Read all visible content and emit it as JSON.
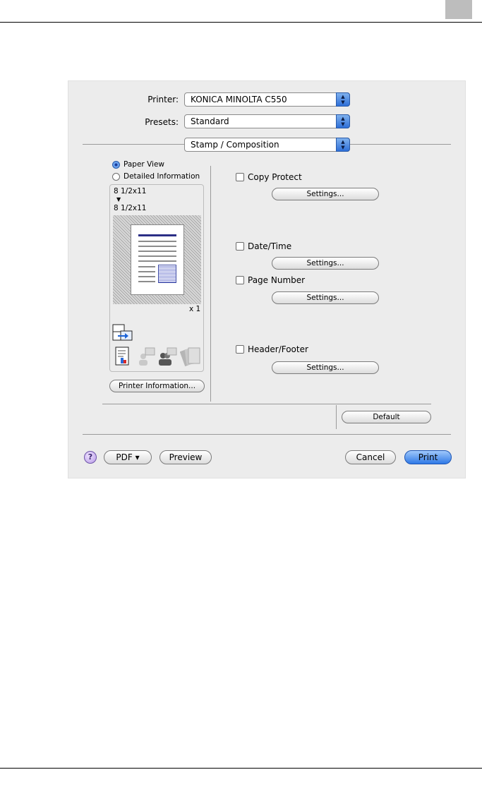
{
  "page": {
    "corner_tab_color": "#bdbdbd"
  },
  "dialog": {
    "printer_label": "Printer:",
    "printer_value": "KONICA MINOLTA C550",
    "presets_label": "Presets:",
    "presets_value": "Standard",
    "panel_value": "Stamp / Composition",
    "view_options": [
      {
        "label": "Paper View",
        "selected": true
      },
      {
        "label": "Detailed Information",
        "selected": false
      }
    ],
    "paper_from": "8 1/2x11",
    "paper_to": "8 1/2x11",
    "paper_arrow": "▼",
    "copies": "x 1",
    "printer_info_button": "Printer Information...",
    "options": [
      {
        "label": "Copy Protect",
        "checked": false,
        "settings": "Settings..."
      },
      {
        "label": "Date/Time",
        "checked": false,
        "settings": "Settings..."
      },
      {
        "label": "Page Number",
        "checked": false,
        "settings": "Settings..."
      },
      {
        "label": "Header/Footer",
        "checked": false,
        "settings": "Settings..."
      }
    ],
    "default_button": "Default",
    "help_label": "?",
    "pdf_button": "PDF ▾",
    "preview_button": "Preview",
    "cancel_button": "Cancel",
    "print_button": "Print",
    "accent_color": "#2f79e6"
  }
}
